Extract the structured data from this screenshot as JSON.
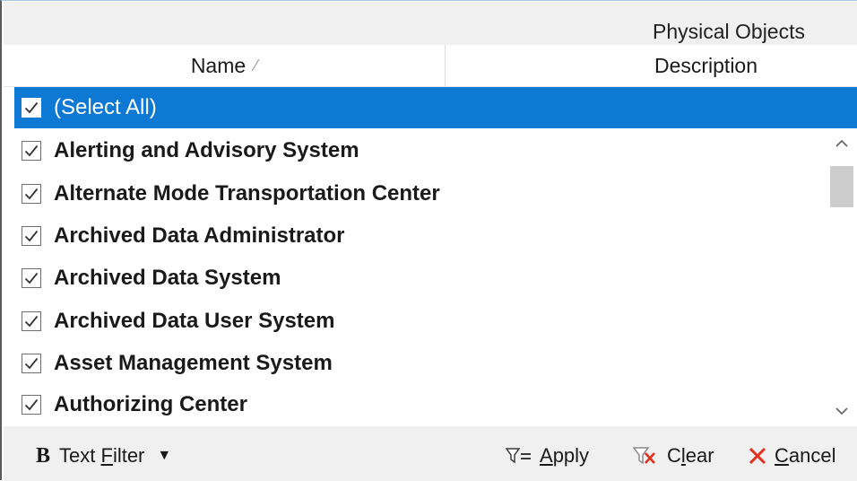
{
  "header": {
    "group_title": "Physical Objects",
    "columns": {
      "name": "Name",
      "description": "Description"
    }
  },
  "list": {
    "select_all": "(Select All)",
    "items": [
      "Alerting and Advisory System",
      "Alternate Mode Transportation Center",
      "Archived Data Administrator",
      "Archived Data System",
      "Archived Data User System",
      "Asset Management System",
      "Authorizing Center"
    ]
  },
  "footer": {
    "text_filter_label_pre": "Text ",
    "text_filter_label_mnemonic": "F",
    "text_filter_label_post": "ilter",
    "apply_mnemonic": "A",
    "apply_rest": "pply",
    "clear_pre": "C",
    "clear_mnemonic": "l",
    "clear_post": "ear",
    "cancel_mnemonic": "C",
    "cancel_rest": "ancel"
  },
  "colors": {
    "selection": "#0e78d5",
    "cancel_icon": "#e0301e",
    "clear_icon": "#e0301e"
  },
  "icons": [
    "check-icon",
    "sort-indicator-icon",
    "scroll-up-icon",
    "scroll-down-icon",
    "bold-icon",
    "dropdown-arrow-icon",
    "filter-apply-icon",
    "filter-clear-icon",
    "cancel-x-icon"
  ]
}
